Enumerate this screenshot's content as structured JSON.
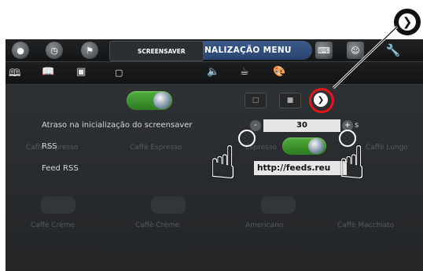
{
  "header": {
    "menu_title": "PERSONALIZAÇÃO MENU"
  },
  "subnav": {
    "active_tab": "SCREENSAVER"
  },
  "settings": {
    "startup_delay_label": "Atraso na inicialização do screensaver",
    "startup_delay_value": "30",
    "startup_delay_unit": "s",
    "minus_label": "-",
    "plus_label": "+",
    "rss_label": "RSS",
    "feed_label": "Feed RSS",
    "feed_value": "http://feeds.reu"
  },
  "background_drinks": [
    "Caffè Espresso",
    "Caffè Espresso",
    "Espresso",
    "Caffè Lungo",
    "Caffè Crème",
    "Caffè Crème",
    "Americano",
    "Caffè Macchiato"
  ],
  "colors": {
    "toggle_on": "#3d9a2c",
    "highlight_ring": "#e3141c",
    "menu_pill": "#2e4c7c"
  },
  "icons": {
    "callout": "chevron-right-circle-icon",
    "hands": "tap-hand-icon"
  }
}
